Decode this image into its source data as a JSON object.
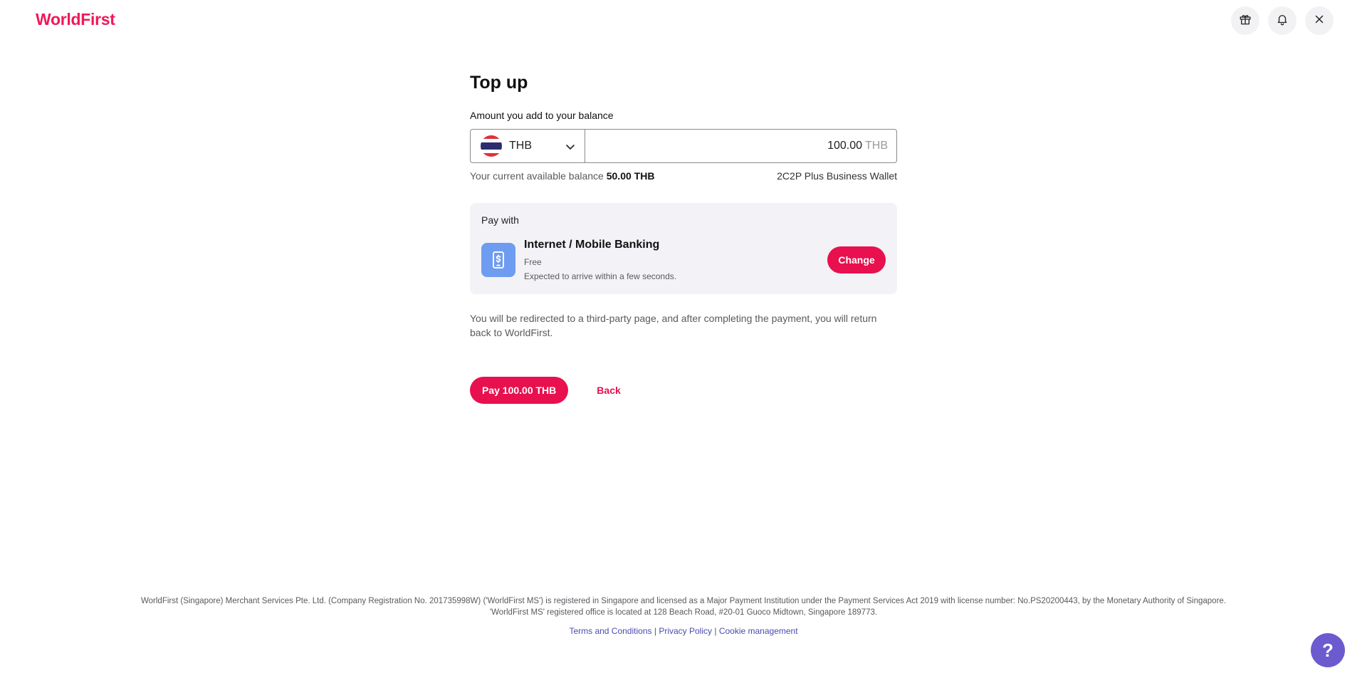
{
  "header": {
    "logo_text": "WorldFirst",
    "icons": [
      "gift-icon",
      "bell-icon",
      "close-icon"
    ]
  },
  "page": {
    "title": "Top up",
    "amount_label": "Amount you add to your balance",
    "currency": {
      "code": "THB",
      "flag": "thailand-flag-icon"
    },
    "amount": {
      "value": "100.00",
      "unit": "THB"
    },
    "balance": {
      "label": "Your current available balance",
      "value": "50.00 THB",
      "wallet": "2C2P Plus Business Wallet"
    }
  },
  "pay_with": {
    "heading": "Pay with",
    "method_title": "Internet / Mobile Banking",
    "fee": "Free",
    "eta": "Expected to arrive within a few seconds.",
    "change_label": "Change",
    "icon": "mobile-payment-icon",
    "icon_color": "#6e9cf0"
  },
  "redirect_note": "You will be redirected to a third-party page, and after completing the payment, you will return back to WorldFirst.",
  "actions": {
    "pay_label": "Pay 100.00 THB",
    "back_label": "Back"
  },
  "footer": {
    "legal": "WorldFirst (Singapore) Merchant Services Pte. Ltd. (Company Registration No. 201735998W) ('WorldFirst MS') is registered in Singapore and licensed as a Major Payment Institution under the Payment Services Act 2019 with license number: No.PS20200443, by the Monetary Authority of Singapore. 'WorldFirst MS' registered office is located at 128 Beach Road, #20-01 Guoco Midtown, Singapore 189773.",
    "terms": "Terms and Conditions",
    "privacy": "Privacy Policy",
    "cookies": "Cookie management",
    "separator": "|"
  },
  "help": {
    "label": "?"
  },
  "colors": {
    "brand": "#e8104f",
    "help": "#6b5bcf",
    "link": "#4b4bb0"
  }
}
